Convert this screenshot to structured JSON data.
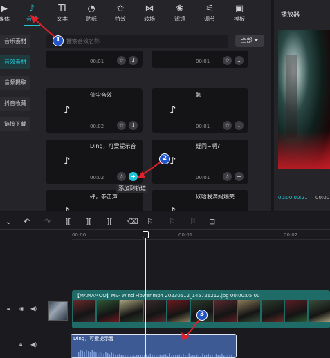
{
  "toolbar": {
    "tools": [
      {
        "label": "媒体",
        "icon": "media-icon",
        "glyph": "▶"
      },
      {
        "label": "音频",
        "icon": "audio-icon",
        "glyph": "♪"
      },
      {
        "label": "文本",
        "icon": "text-icon",
        "glyph": "TI"
      },
      {
        "label": "贴纸",
        "icon": "sticker-icon",
        "glyph": "◔"
      },
      {
        "label": "特效",
        "icon": "effects-icon",
        "glyph": "✩"
      },
      {
        "label": "转场",
        "icon": "transition-icon",
        "glyph": "⋈"
      },
      {
        "label": "滤镜",
        "icon": "filter-icon",
        "glyph": "❀"
      },
      {
        "label": "调节",
        "icon": "adjust-icon",
        "glyph": "⚟"
      },
      {
        "label": "模板",
        "icon": "template-icon",
        "glyph": "▣"
      }
    ],
    "active_index": 1
  },
  "sidebar": {
    "items": [
      "音乐素材",
      "音效素材",
      "音频提取",
      "抖音收藏",
      "链接下载"
    ],
    "active_index": 1
  },
  "search": {
    "placeholder": "搜索音效名称",
    "filter_label": "全部"
  },
  "cards": [
    {
      "name": "",
      "duration": "00:01",
      "action": "download"
    },
    {
      "name": "",
      "duration": "00:01",
      "action": "download"
    },
    {
      "name": "仙尘音效",
      "duration": "00:02",
      "action": "download"
    },
    {
      "name": "聊",
      "duration": "00:01",
      "action": "download"
    },
    {
      "name": "Ding，可爱提示音",
      "duration": "00:02",
      "action": "add"
    },
    {
      "name": "疑问~啊?",
      "duration": "00:01",
      "action": "add-plain"
    },
    {
      "name": "砰，拳击声",
      "duration": "",
      "action": "none"
    },
    {
      "name": "砍哈我滴妈爆笑",
      "duration": "",
      "action": "none"
    }
  ],
  "tooltip": "添加到轨道",
  "player": {
    "title": "播放器",
    "current_time": "00:00:00:21",
    "total_time_partial": "00:00"
  },
  "timeline": {
    "ruler": [
      "00:00",
      "00:01",
      "00:02"
    ],
    "video_clip_label": "【MAMAMOO】MV- Wind Flower.mp4   20230512_145726212.jpg   00:00:05:00",
    "audio_clip_label": "Ding，可爱提示音"
  },
  "annotations": [
    "1",
    "2",
    "3"
  ],
  "colors": {
    "accent": "#21c7d6",
    "annotation": "#e0202a",
    "marker": "#2355c8"
  }
}
